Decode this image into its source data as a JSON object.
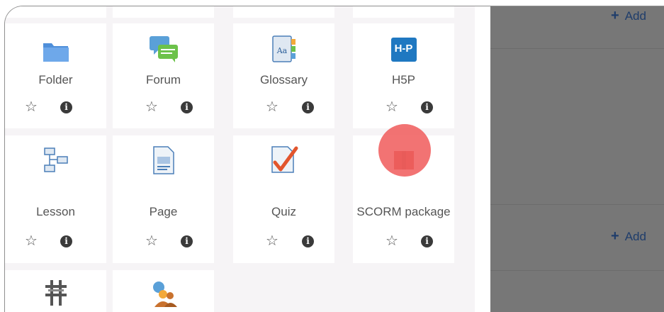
{
  "activities": [
    {
      "label": "Folder",
      "icon": "folder-icon"
    },
    {
      "label": "Forum",
      "icon": "forum-icon"
    },
    {
      "label": "Glossary",
      "icon": "glossary-icon"
    },
    {
      "label": "H5P",
      "icon": "h5p-icon",
      "icon_text": "H-P"
    },
    {
      "label": "Lesson",
      "icon": "lesson-icon"
    },
    {
      "label": "Page",
      "icon": "page-icon"
    },
    {
      "label": "Quiz",
      "icon": "quiz-icon"
    },
    {
      "label": "SCORM package",
      "icon": "scorm-package-icon"
    },
    {
      "label": "",
      "icon": "workshop-icon"
    },
    {
      "label": "",
      "icon": "users-icon"
    }
  ],
  "right_panel": {
    "add_top": "Add",
    "add_middle": "Add"
  },
  "colors": {
    "overlay": "#777777",
    "add_link": "#1f3d6b",
    "cursor": "#f06060"
  }
}
